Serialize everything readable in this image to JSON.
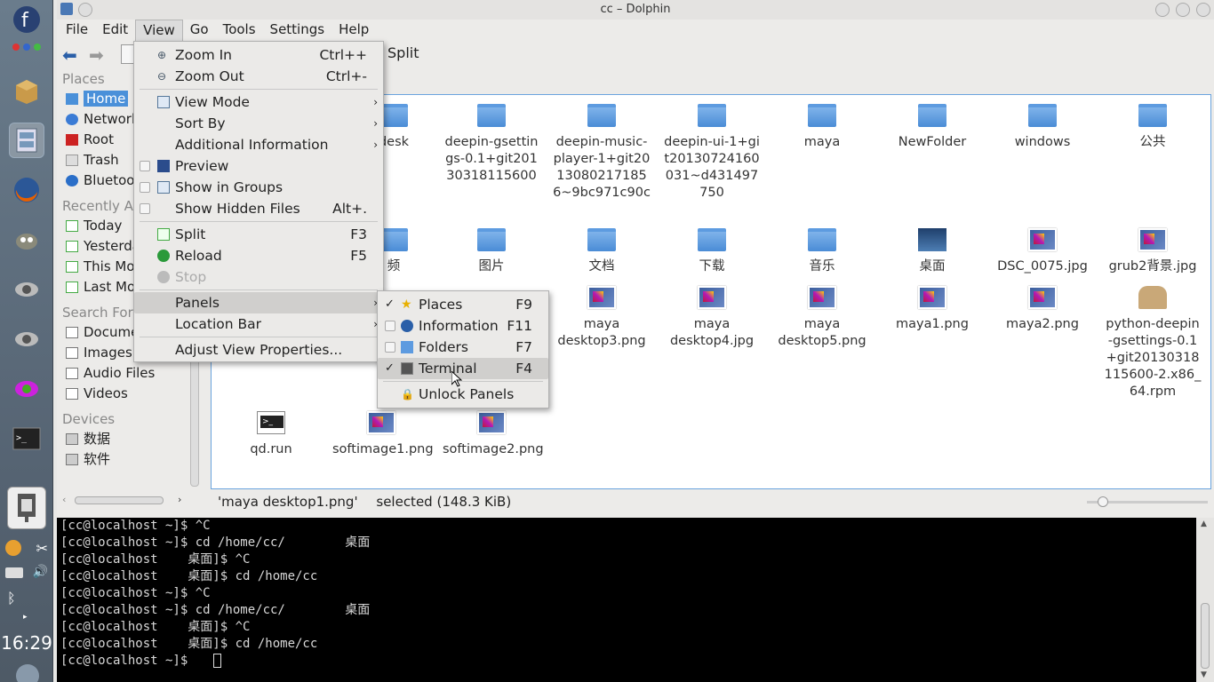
{
  "window": {
    "title": "cc – Dolphin"
  },
  "menubar": [
    "File",
    "Edit",
    "View",
    "Go",
    "Tools",
    "Settings",
    "Help"
  ],
  "toolbar": {
    "split_label": "Split"
  },
  "places": {
    "places_head": "Places",
    "items": [
      "Home",
      "Network",
      "Root",
      "Trash",
      "Bluetooth"
    ],
    "recent_head": "Recently Accessed",
    "recent": [
      "Today",
      "Yesterday",
      "This Month",
      "Last Month"
    ],
    "search_head": "Search For",
    "search": [
      "Documents",
      "Images",
      "Audio Files",
      "Videos"
    ],
    "devices_head": "Devices",
    "devices": [
      "数据",
      "软件"
    ]
  },
  "view_menu": {
    "zoom_in": "Zoom In",
    "zoom_in_sc": "Ctrl++",
    "zoom_out": "Zoom Out",
    "zoom_out_sc": "Ctrl+-",
    "view_mode": "View Mode",
    "sort_by": "Sort By",
    "additional_info": "Additional Information",
    "preview": "Preview",
    "show_groups": "Show in Groups",
    "show_hidden": "Show Hidden Files",
    "show_hidden_sc": "Alt+.",
    "split": "Split",
    "split_sc": "F3",
    "reload": "Reload",
    "reload_sc": "F5",
    "stop": "Stop",
    "panels": "Panels",
    "location_bar": "Location Bar",
    "adjust": "Adjust View Properties..."
  },
  "panels_menu": {
    "places": "Places",
    "places_sc": "F9",
    "information": "Information",
    "information_sc": "F11",
    "folders": "Folders",
    "folders_sc": "F7",
    "terminal": "Terminal",
    "terminal_sc": "F4",
    "unlock": "Unlock Panels"
  },
  "files_row1": [
    "desk",
    "deepin-gsettings-0.1+git20130318115600",
    "deepin-music-player-1+git20130802171856~9bc971c90c",
    "deepin-ui-1+git20130724160031~d431497750",
    "maya",
    "NewFolder",
    "windows",
    "公共"
  ],
  "files_row2": [
    "频",
    "图片",
    "文档",
    "下载",
    "音乐",
    "桌面",
    "DSC_0075.jpg",
    "grub2背景.jpg"
  ],
  "files_row3": [
    "maya desktop3.png",
    "maya desktop4.jpg",
    "maya desktop5.png",
    "maya1.png",
    "maya2.png",
    "python-deepin-gsettings-0.1+git20130318115600-2.x86_64.rpm"
  ],
  "files_row4": [
    "qd.run",
    "softimage1.png",
    "softimage2.png"
  ],
  "status": {
    "name": "'maya desktop1.png'",
    "detail": "selected (148.3 KiB)"
  },
  "terminal_lines": [
    "[cc@localhost ~]$ ^C",
    "[cc@localhost ~]$ cd /home/cc/        桌面",
    "[cc@localhost    桌面]$ ^C",
    "[cc@localhost    桌面]$ cd /home/cc",
    "[cc@localhost ~]$ ^C",
    "[cc@localhost ~]$ cd /home/cc/        桌面",
    "[cc@localhost    桌面]$ ^C",
    "[cc@localhost    桌面]$ cd /home/cc",
    "[cc@localhost ~]$ "
  ],
  "clock": "16:29"
}
